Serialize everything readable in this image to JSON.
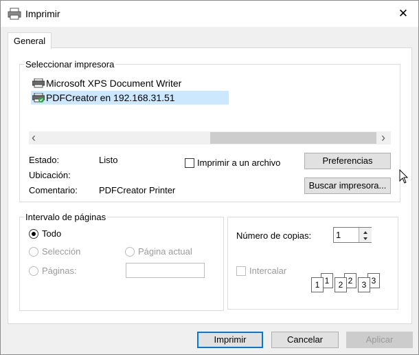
{
  "window": {
    "title": "Imprimir",
    "close_glyph": "✕"
  },
  "tabs": [
    {
      "label": "General"
    }
  ],
  "select_printer": {
    "legend": "Seleccionar impresora",
    "printers": [
      {
        "name": "Microsoft XPS Document Writer",
        "selected": false
      },
      {
        "name": "PDFCreator en 192.168.31.51",
        "selected": true
      }
    ],
    "scroll_left": "‹",
    "scroll_right": "›",
    "status_label": "Estado:",
    "status_value": "Listo",
    "location_label": "Ubicación:",
    "location_value": "",
    "comment_label": "Comentario:",
    "comment_value": "PDFCreator Printer",
    "print_to_file_label": "Imprimir a un archivo",
    "print_to_file_checked": false,
    "preferences_button": "Preferencias",
    "find_printer_button": "Buscar impresora..."
  },
  "page_range": {
    "legend": "Intervalo de páginas",
    "all_label": "Todo",
    "selection_label": "Selección",
    "current_page_label": "Página actual",
    "pages_label": "Páginas:",
    "pages_value": "",
    "selected": "all"
  },
  "copies": {
    "label": "Número de copias:",
    "value": "1",
    "collate_label": "Intercalar",
    "collate_checked": false,
    "collate_pages": [
      "1",
      "1",
      "2",
      "2",
      "3",
      "3"
    ]
  },
  "footer": {
    "print_button": "Imprimir",
    "cancel_button": "Cancelar",
    "apply_button": "Aplicar"
  },
  "colors": {
    "selection": "#cce8ff",
    "accent": "#0078d7",
    "printer_status_ok": "#2e9e44"
  }
}
